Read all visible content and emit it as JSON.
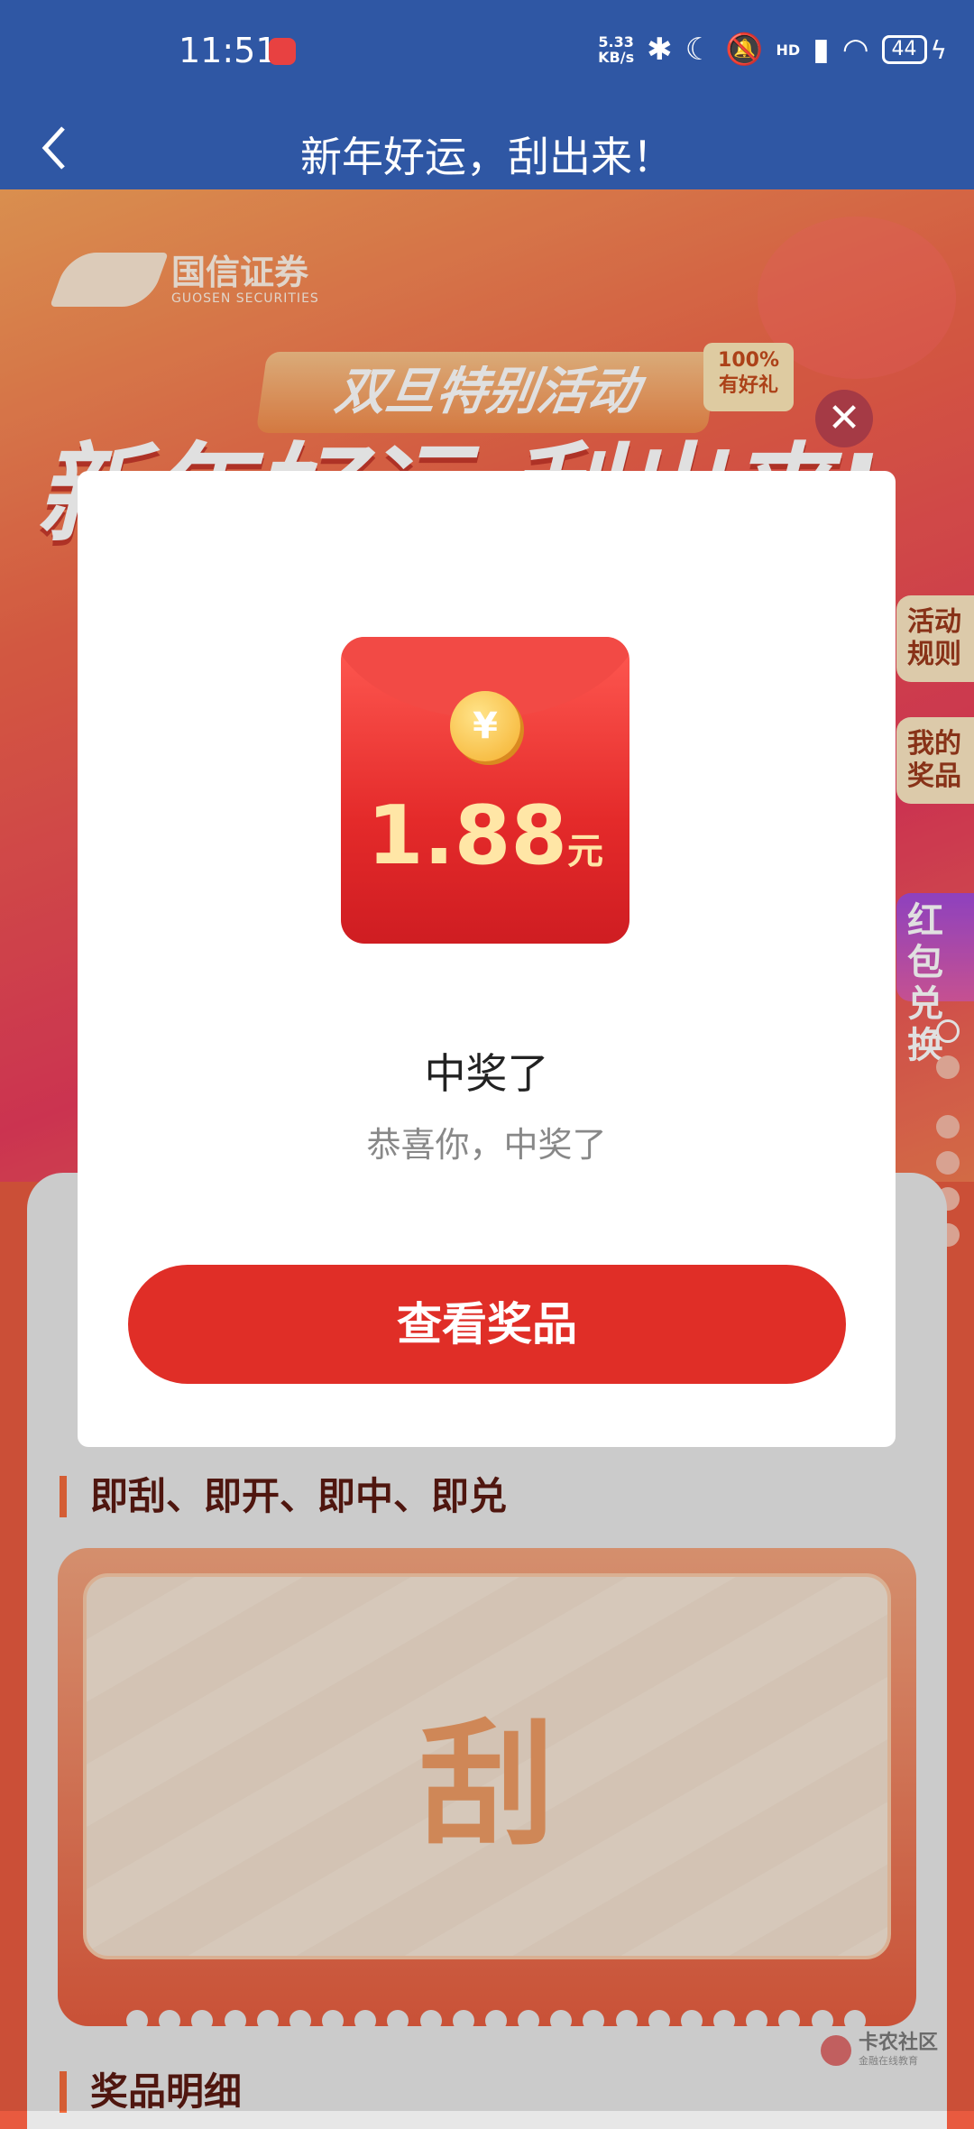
{
  "status_bar": {
    "time": "11:51",
    "net_speed_value": "5.33",
    "net_speed_unit": "KB/s",
    "hd": "HD",
    "battery": "44"
  },
  "titlebar": {
    "title": "新年好运，刮出来！"
  },
  "background": {
    "brand_cn": "国信证券",
    "brand_en": "GUOSEN SECURITIES",
    "event_ribbon": "双旦特别活动",
    "gift_badge_line1": "100%",
    "gift_badge_line2": "有好礼",
    "big_title": "新年好运 刮出来!",
    "side_tabs": {
      "rules_line1": "活动",
      "rules_line2": "规则",
      "prizes_line1": "我的",
      "prizes_line2": "奖品",
      "exchange_line1": "红包",
      "exchange_line2": "兑换"
    },
    "scratch_section_label": "即刮、即开、即中、即兑",
    "scratch_glyph": "刮",
    "prize_detail_label": "奖品明细",
    "watermark": "卡农社区",
    "watermark_sub": "金融在线教育"
  },
  "modal": {
    "close_symbol": "✕",
    "coin_symbol": "¥",
    "amount_value": "1.88",
    "amount_unit": "元",
    "title": "中奖了",
    "subtitle": "恭喜你，中奖了",
    "button_label": "查看奖品"
  },
  "colors": {
    "title_bar": "#2f57a4",
    "primary_button": "#e02e27",
    "envelope_red": "#e42a2a",
    "amount_gold": "#ffe6a6"
  }
}
